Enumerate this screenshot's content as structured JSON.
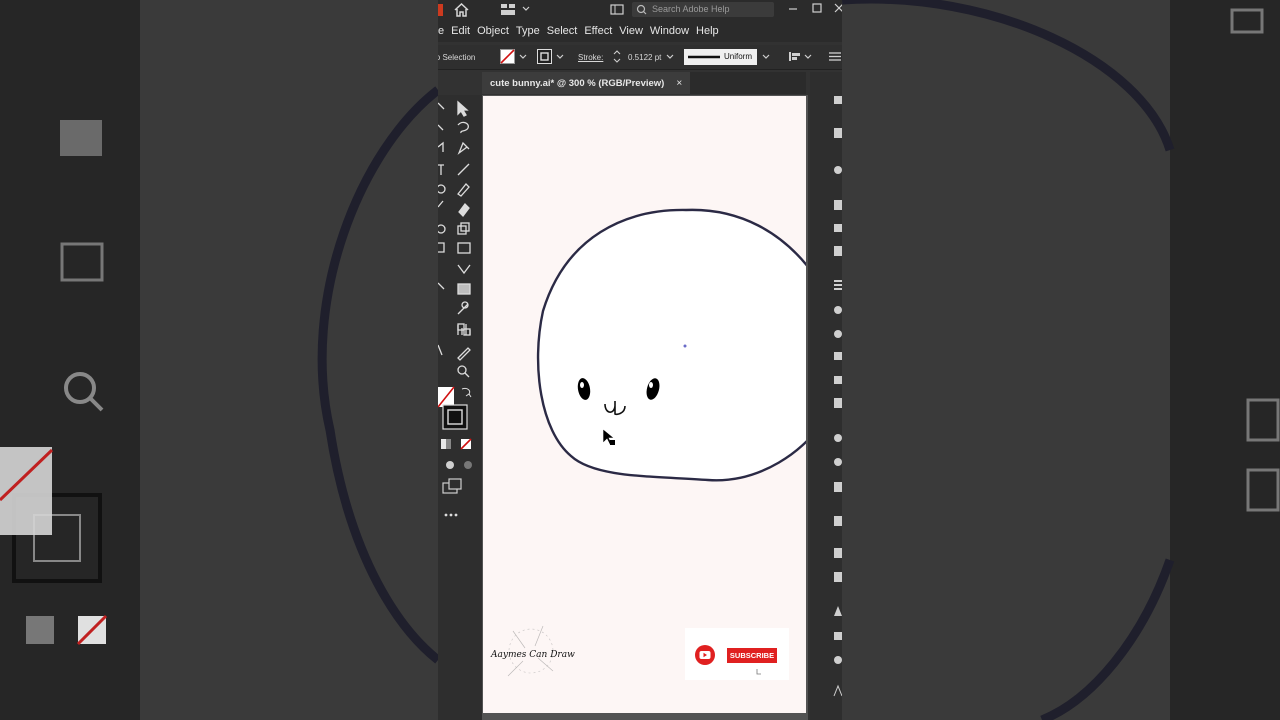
{
  "app": {
    "search_placeholder": "Search Adobe Help",
    "menu": [
      "e",
      "Edit",
      "Object",
      "Type",
      "Select",
      "Effect",
      "View",
      "Window",
      "Help"
    ]
  },
  "control_bar": {
    "selection_label": "No Selection",
    "stroke_label": "Stroke:",
    "stroke_value": "0.5122 pt",
    "profile_label": "Uniform"
  },
  "document_tab": {
    "title": "cute bunny.ai* @ 300 % (RGB/Preview)",
    "close_symbol": "×"
  },
  "artwork": {
    "watermark_signature": "Aaymes Can Draw",
    "subscribe_label": "SUBSCRIBE"
  },
  "colors": {
    "artboard": "#fdf6f5",
    "outline": "#2b2a45",
    "youtube_red": "#e02020",
    "chrome_dark": "#2b2b2b"
  }
}
